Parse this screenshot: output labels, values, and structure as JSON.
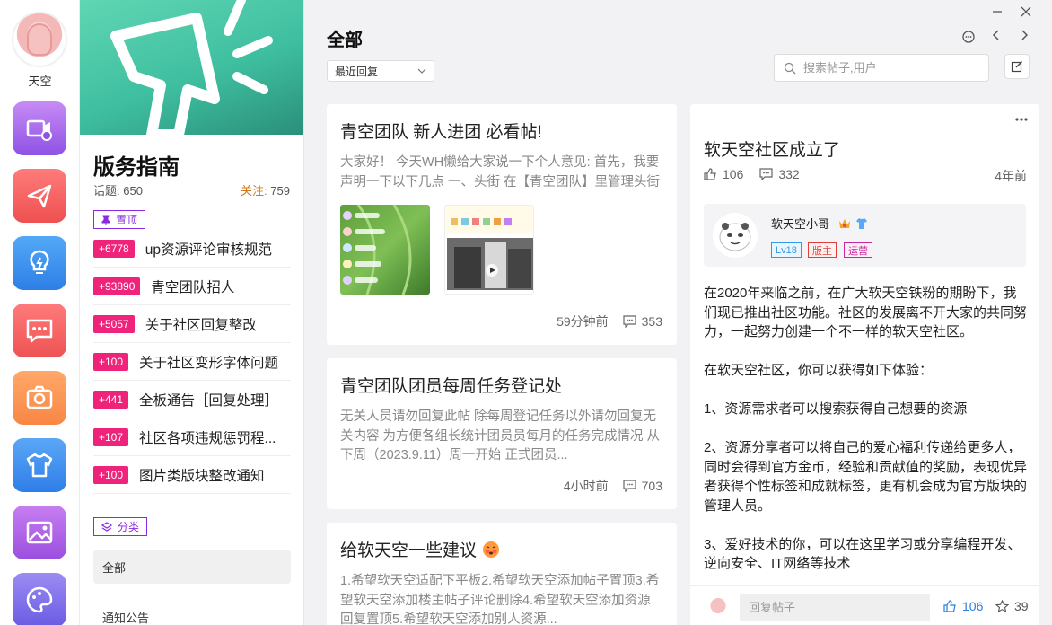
{
  "user": {
    "name": "天空"
  },
  "rail_apps": [
    {
      "icon": "video-icon",
      "color_top": "#c78bf4",
      "color_bottom": "#8e52e6"
    },
    {
      "icon": "send-icon",
      "color_top": "#ff7b7b",
      "color_bottom": "#ef5050"
    },
    {
      "icon": "lightbulb-icon",
      "color_top": "#53a9f6",
      "color_bottom": "#2e7fe6"
    },
    {
      "icon": "message-icon",
      "color_top": "#ff7b7b",
      "color_bottom": "#ee5353"
    },
    {
      "icon": "camera-icon",
      "color_top": "#ffa86a",
      "color_bottom": "#f98644"
    },
    {
      "icon": "shirt-icon",
      "color_top": "#5aa7f7",
      "color_bottom": "#2f7ee8"
    },
    {
      "icon": "image-icon",
      "color_top": "#c77ef0",
      "color_bottom": "#9b4fe0"
    },
    {
      "icon": "palette-icon",
      "color_top": "#9b8cf2",
      "color_bottom": "#6a5ce3"
    }
  ],
  "panel": {
    "title": "版务指南",
    "topics_label": "话题:",
    "topics_count": "650",
    "follow_label": "关注:",
    "follow_count": "759",
    "pinned_chip": "置顶",
    "pinned": [
      {
        "badge": "+6778",
        "text": "up资源评论审核规范"
      },
      {
        "badge": "+93890",
        "text": "青空团队招人"
      },
      {
        "badge": "+5057",
        "text": "关于社区回复整改"
      },
      {
        "badge": "+100",
        "text": "关于社区变形字体问题"
      },
      {
        "badge": "+441",
        "text": "全板通告［回复处理］"
      },
      {
        "badge": "+107",
        "text": "社区各项违规惩罚程..."
      },
      {
        "badge": "+100",
        "text": "图片类版块整改通知"
      }
    ],
    "category_chip": "分类",
    "categories": [
      "全部",
      "通知公告"
    ]
  },
  "main": {
    "title": "全部",
    "sort_value": "最近回复",
    "search_placeholder": "搜索帖子,用户",
    "posts": [
      {
        "title": "青空团队 新人进团 必看帖!",
        "excerpt": "大家好！ 今天WH懒给大家说一下个人意见: 首先，我要声明一下以下几点 一、头街 在【青空团队】里管理头街是要找小天空 如果没有回你 可以...",
        "time": "59分钟前",
        "comments": "353"
      },
      {
        "title": "青空团队团员每周任务登记处",
        "excerpt": "无关人员请勿回复此帖 除每周登记任务以外请勿回复无关内容 为方便各组长统计团员员每月的任务完成情况 从下周（2023.9.11）周一开始 正式团员...",
        "time": "4小时前",
        "comments": "703"
      },
      {
        "title": "给软天空一些建议",
        "excerpt": "1.希望软天空适配下平板2.希望软天空添加帖子置顶3.希望软天空添加楼主帖子评论删除4.希望软天空添加资源回复置顶5.希望软天空添加别人资源..."
      }
    ]
  },
  "detail": {
    "title": "软天空社区成立了",
    "likes": "106",
    "comments": "332",
    "time": "4年前",
    "author": {
      "name": "软天空小哥",
      "tags": [
        {
          "text": "Lv18",
          "color": "#2f9be8"
        },
        {
          "text": "版主",
          "color": "#e0403a"
        },
        {
          "text": "运营",
          "color": "#c62a9a"
        }
      ]
    },
    "paragraphs": [
      "在2020年来临之前，在广大软天空铁粉的期盼下，我们现已推出社区功能。社区的发展离不开大家的共同努力，一起努力创建一个不一样的软天空社区。",
      "在软天空社区，你可以获得如下体验：",
      "1、资源需求者可以搜索获得自己想要的资源",
      "2、资源分享者可以将自己的爱心福利传递给更多人，同时会得到官方金币，经验和贡献值的奖励，表现优异者获得个性标签和成就标签，更有机会成为官方版块的管理人员。",
      "3、爱好技术的你，可以在这里学习或分享编程开发、逆向安全、IT网络等技术"
    ],
    "reply_placeholder": "回复帖子",
    "reply_likes": "106",
    "reply_stars": "39"
  },
  "colors": {
    "accent": "#f0237a",
    "purple": "#8a2be2",
    "blue": "#2a7be0"
  }
}
